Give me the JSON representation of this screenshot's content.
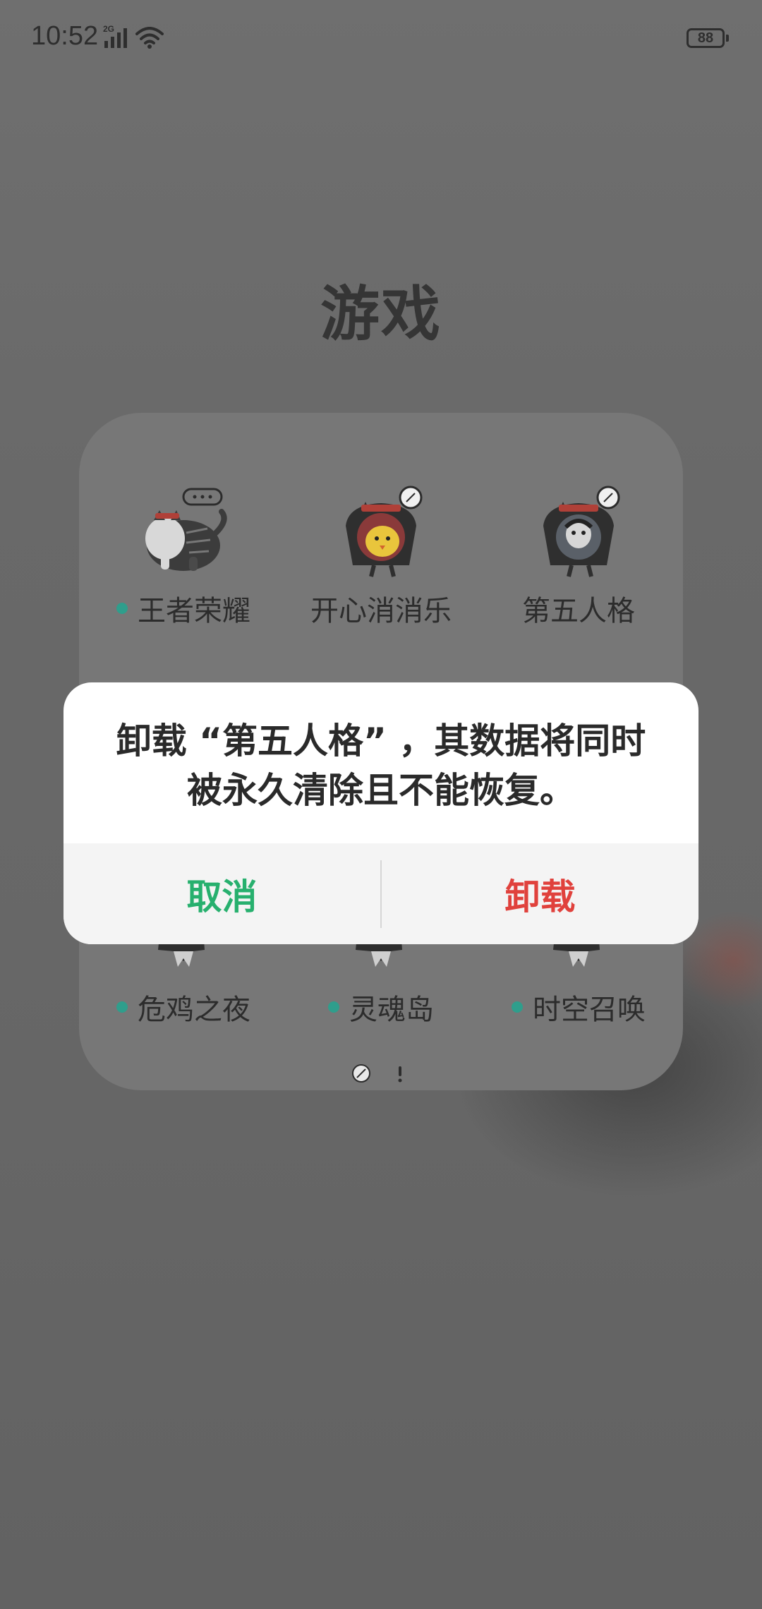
{
  "status_bar": {
    "time": "10:52",
    "network_type": "2G",
    "battery_level": "88"
  },
  "folder": {
    "title": "游戏",
    "apps": [
      {
        "label": "王者荣耀",
        "has_update_dot": true,
        "icon": "cat-mascot-icon"
      },
      {
        "label": "开心消消乐",
        "has_update_dot": false,
        "icon": "cat-mascot-chick-icon"
      },
      {
        "label": "第五人格",
        "has_update_dot": false,
        "icon": "cat-mascot-doll-icon"
      },
      {
        "label": "危鸡之夜",
        "has_update_dot": true,
        "icon": "cat-mascot-icon"
      },
      {
        "label": "灵魂岛",
        "has_update_dot": true,
        "icon": "cat-mascot-icon"
      },
      {
        "label": "时空召唤",
        "has_update_dot": true,
        "icon": "cat-mascot-icon"
      }
    ],
    "page_indicator": "page-indicator-icon"
  },
  "dialog": {
    "message": "卸载 “第五人格” ，其数据将同时被永久清除且不能恢复。",
    "cancel_label": "取消",
    "confirm_label": "卸载"
  },
  "colors": {
    "cancel": "#27b06e",
    "confirm": "#e0413c",
    "update_dot": "#2f9e8c"
  }
}
